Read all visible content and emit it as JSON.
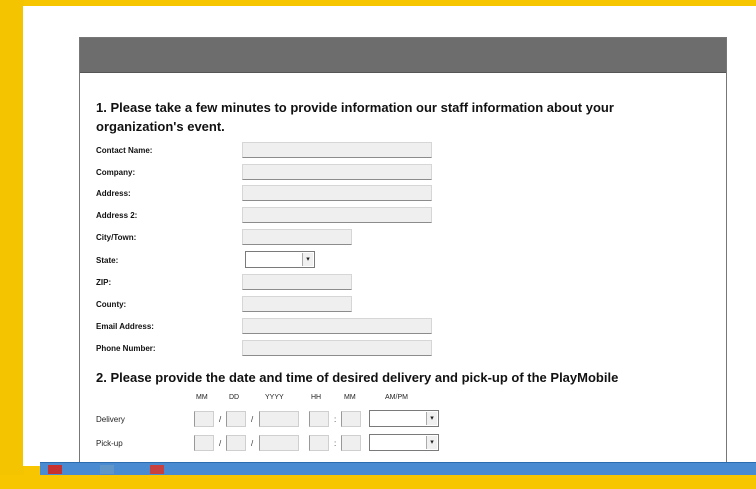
{
  "section1": {
    "title": "1. Please take a few minutes to provide information our staff information about your organization's event."
  },
  "fields": [
    {
      "label": "Contact Name:"
    },
    {
      "label": "Company:"
    },
    {
      "label": "Address:"
    },
    {
      "label": "Address 2:"
    },
    {
      "label": "City/Town:"
    },
    {
      "label": "State:"
    },
    {
      "label": "ZIP:"
    },
    {
      "label": "County:"
    },
    {
      "label": "Email Address:"
    },
    {
      "label": "Phone Number:"
    }
  ],
  "section2": {
    "title": "2. Please provide the date and time of desired delivery and pick-up of the PlayMobile",
    "columns": [
      "MM",
      "DD",
      "YYYY",
      "HH",
      "MM",
      "AM/PM"
    ],
    "rows": [
      "Delivery",
      "Pick-up"
    ],
    "date_sep": "/",
    "time_sep": ":"
  },
  "icons": {
    "select_arrow": "▾"
  }
}
